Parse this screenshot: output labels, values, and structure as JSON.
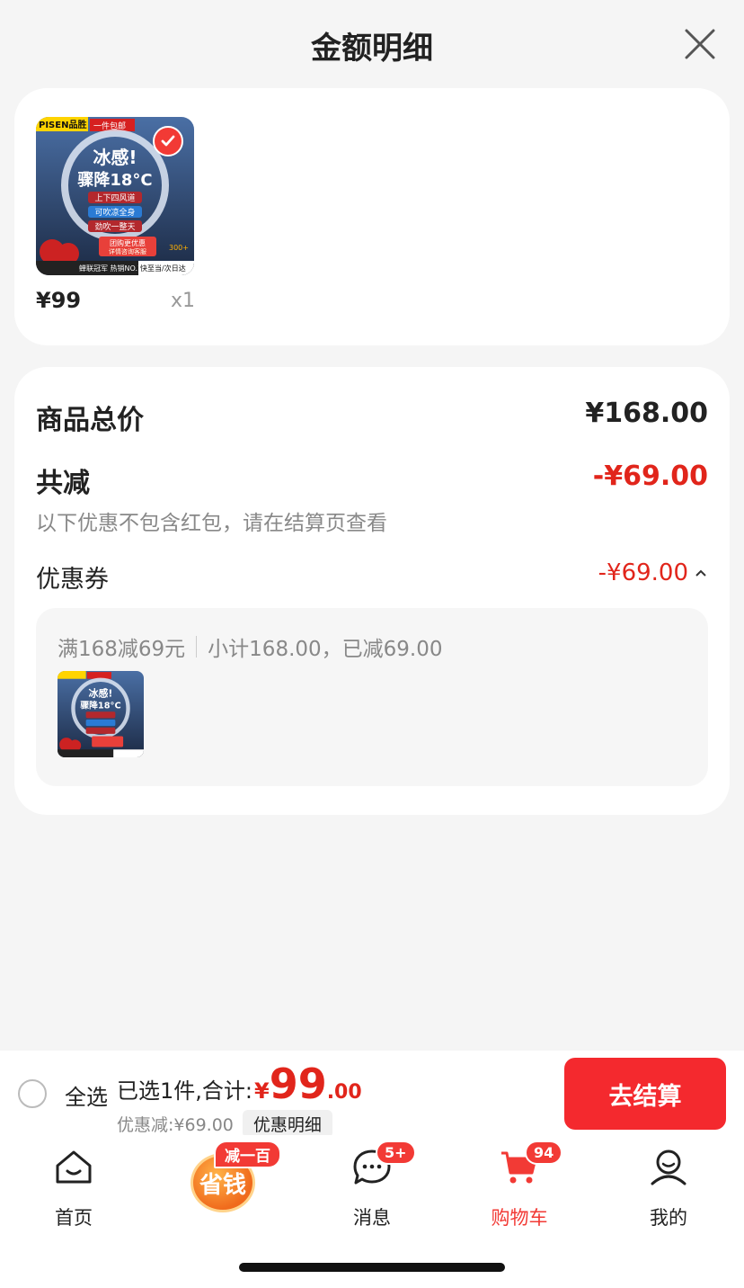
{
  "sheet": {
    "title": "金额明细"
  },
  "product": {
    "price": "¥99",
    "quantity": "x1",
    "image": {
      "brand": "PISEN品胜",
      "tag": "一件包邮",
      "headline1": "冰感!",
      "headline2": "骤降18°C",
      "features": [
        "上下四风道",
        "可吹凉全身",
        "劲吹一整天"
      ],
      "promo": "团购更优惠",
      "promo_sub": "详情咨询客服",
      "badge_300": "300+",
      "bottom_left": "蝉联冠军 热销NO.1",
      "bottom_right": "快至当/次日达"
    }
  },
  "detail": {
    "total_label": "商品总价",
    "total_value": "¥168.00",
    "reduce_label": "共减",
    "reduce_value": "-¥69.00",
    "note": "以下优惠不包含红包，请在结算页查看",
    "coupon_label": "优惠券",
    "coupon_value": "-¥69.00",
    "coupon_rule": "满168减69元",
    "coupon_subtotal": "小计168.00，已减69.00"
  },
  "checkout": {
    "select_all": "全选",
    "selected_text": "已选1件,合计:",
    "currency": "¥",
    "total_int": "99",
    "total_dec": ".00",
    "discount_text": "优惠减:¥69.00",
    "detail_pill": "优惠明细",
    "button": "去结算"
  },
  "tabbar": {
    "home": "首页",
    "promo_text": "省钱",
    "promo_badge": "减一百",
    "messages": "消息",
    "messages_badge": "5+",
    "cart": "购物车",
    "cart_badge": "94",
    "mine": "我的"
  },
  "colors": {
    "accent_red": "#e1251b",
    "button_red": "#f4292e",
    "background": "#f5f5f5"
  }
}
